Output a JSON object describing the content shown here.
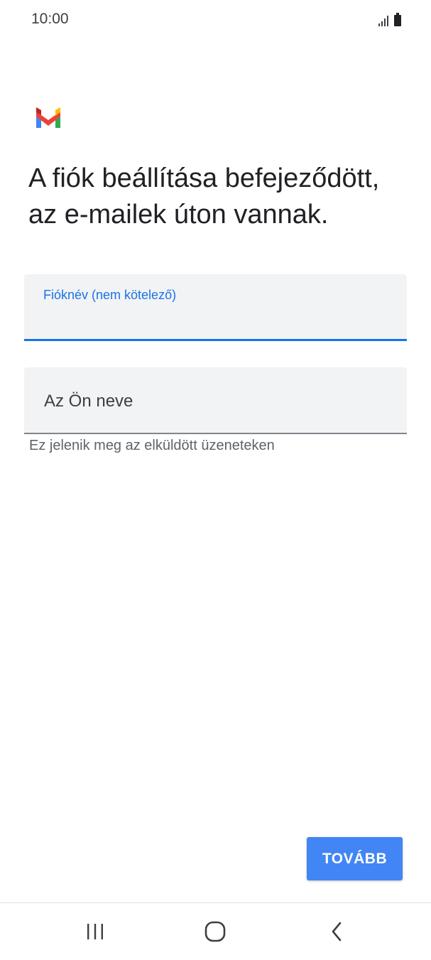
{
  "status_bar": {
    "time": "10:00",
    "signal_icon": "signal-icon",
    "battery_icon": "battery-icon"
  },
  "app": {
    "logo_icon": "gmail-logo-icon",
    "brand_colors": {
      "blue": "#4285F4",
      "red": "#EA4335",
      "yellow": "#FBBC04",
      "green": "#34A853"
    }
  },
  "heading": "A fiók beállítása befejeződött, az e-mailek úton vannak.",
  "account_name_field": {
    "label": "Fióknév (nem kötelező)",
    "value": "",
    "accent_color": "#1a73e8"
  },
  "your_name_field": {
    "placeholder": "Az Ön neve",
    "value": "",
    "helper_text": "Ez jelenik meg az elküldött üzeneteken"
  },
  "next_button": {
    "label": "TOVÁBB",
    "color": "#4285f4"
  },
  "nav_bar": {
    "recents_icon": "recents-icon",
    "home_icon": "home-icon",
    "back_icon": "back-icon"
  }
}
